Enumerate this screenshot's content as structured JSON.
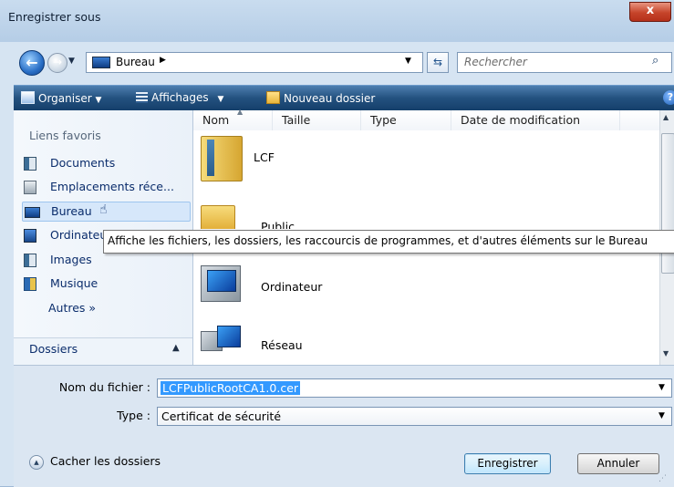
{
  "window": {
    "title": "Enregistrer sous",
    "close_glyph": "x"
  },
  "nav": {
    "back_glyph": "←",
    "forward_glyph": "→",
    "address": {
      "crumb": "Bureau",
      "separator": "▶",
      "dropdown": "▼"
    },
    "refresh_glyph": "⇆",
    "search": {
      "placeholder": "Rechercher",
      "icon_glyph": "⌕"
    }
  },
  "toolbar": {
    "organize": "Organiser",
    "views": "Affichages",
    "new_folder": "Nouveau dossier",
    "arrow": "▼",
    "help": "?"
  },
  "sidebar": {
    "favorites_header": "Liens favoris",
    "items": [
      {
        "label": "Documents",
        "icon": "documents-icon"
      },
      {
        "label": "Emplacements réce...",
        "icon": "recent-places-icon"
      },
      {
        "label": "Bureau",
        "icon": "desktop-icon",
        "selected": true
      },
      {
        "label": "Ordinateur",
        "icon": "computer-icon"
      },
      {
        "label": "Images",
        "icon": "pictures-icon"
      },
      {
        "label": "Musique",
        "icon": "music-icon"
      }
    ],
    "more": "Autres »",
    "folders_label": "Dossiers",
    "folders_caret": "▲"
  },
  "columns": [
    "Nom",
    "Taille",
    "Type",
    "Date de modification"
  ],
  "files": [
    {
      "name": "LCF",
      "icon": "folder-icon"
    },
    {
      "name": "Public",
      "icon": "folder-icon"
    },
    {
      "name": "Ordinateur",
      "icon": "computer-icon"
    },
    {
      "name": "Réseau",
      "icon": "network-icon"
    }
  ],
  "tooltip": "Affiche les fichiers, les dossiers, les raccourcis de programmes, et d'autres éléments sur le Bureau",
  "form": {
    "filename_label": "Nom du fichier :",
    "filename_value": "LCFPublicRootCA1.0.cer",
    "type_label": "Type :",
    "type_value": "Certificat de sécurité",
    "dropdown": "▼"
  },
  "footer": {
    "hide_folders": "Cacher les dossiers",
    "hide_glyph": "▲",
    "save": "Enregistrer",
    "cancel": "Annuler"
  },
  "colors": {
    "accent": "#23517f",
    "selection": "#3399ff",
    "title_bar": "#c9dcef"
  }
}
